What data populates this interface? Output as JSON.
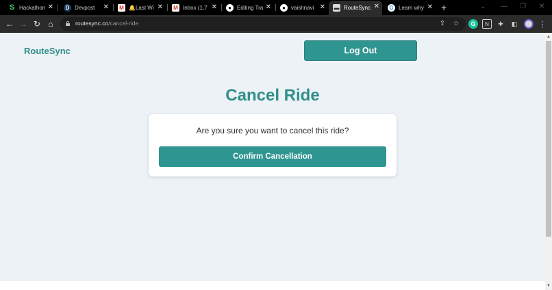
{
  "browser": {
    "tabs": [
      {
        "title": "Hackathon",
        "icon": "devfolio-icon",
        "active": false
      },
      {
        "title": "Devpost",
        "icon": "devpost-icon",
        "active": false
      },
      {
        "title": "🔔Last Wi",
        "icon": "gmail-icon",
        "active": false
      },
      {
        "title": "Inbox (1,7",
        "icon": "gmail-icon",
        "active": false
      },
      {
        "title": "Editing Tra",
        "icon": "github-icon",
        "active": false
      },
      {
        "title": "vaishnavi",
        "icon": "github-icon",
        "active": false
      },
      {
        "title": "RouteSync",
        "icon": "routesync-icon",
        "active": true
      },
      {
        "title": "Learn why",
        "icon": "google-icon",
        "active": false
      }
    ],
    "new_tab_label": "+",
    "url_host": "routesync.co",
    "url_path": "/cancel-ride"
  },
  "app": {
    "brand": "RouteSync",
    "logout_label": "Log Out",
    "page_title": "Cancel Ride",
    "question": "Are you sure you want to cancel this ride?",
    "confirm_label": "Confirm Cancellation"
  },
  "colors": {
    "accent": "#2f9591",
    "brand_text": "#2f8f8a",
    "page_background": "#edf2f7"
  }
}
